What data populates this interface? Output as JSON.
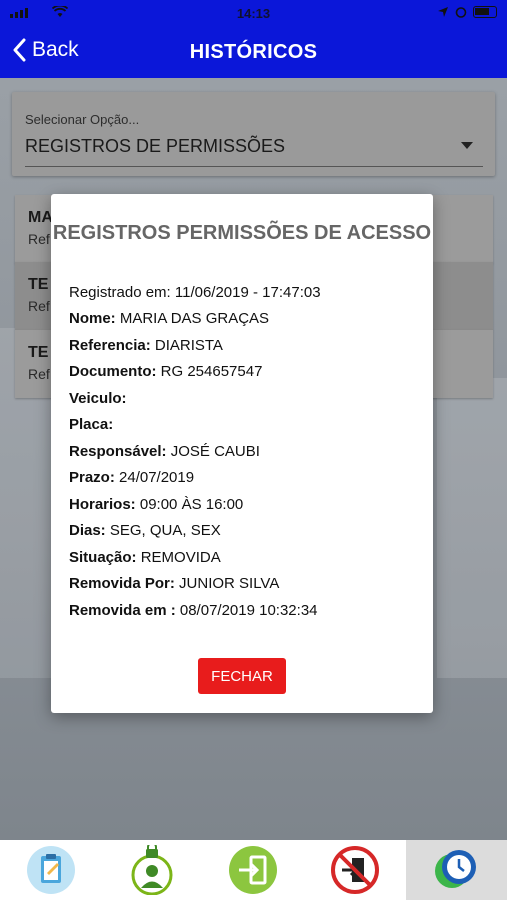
{
  "status_bar": {
    "time": "14:13"
  },
  "header": {
    "back_label": "Back",
    "title": "HISTÓRICOS"
  },
  "select": {
    "label": "Selecionar Opção...",
    "value": "REGISTROS DE PERMISSÕES"
  },
  "list": [
    {
      "title": "MA",
      "subtitle": "Ref"
    },
    {
      "title": "TE",
      "subtitle": "Ref"
    },
    {
      "title": "TE",
      "subtitle": "Ref"
    }
  ],
  "modal": {
    "title": "REGISTROS PERMISSÕES DE ACESSO",
    "registered": "Registrado em: 11/06/2019 - 17:47:03",
    "fields": [
      {
        "label": "Nome:",
        "value": "MARIA DAS GRAÇAS"
      },
      {
        "label": "Referencia:",
        "value": "DIARISTA"
      },
      {
        "label": "Documento:",
        "value": "RG 254657547"
      },
      {
        "label": "Veiculo:",
        "value": ""
      },
      {
        "label": "Placa:",
        "value": ""
      },
      {
        "label": "Responsável:",
        "value": "JOSÉ CAUBI"
      },
      {
        "label": "Prazo:",
        "value": "24/07/2019"
      },
      {
        "label": "Horarios:",
        "value": "09:00 ÀS 16:00"
      },
      {
        "label": "Dias:",
        "value": "SEG, QUA, SEX"
      },
      {
        "label": "Situação:",
        "value": "REMOVIDA"
      },
      {
        "label": "Removida Por:",
        "value": "JUNIOR SILVA"
      },
      {
        "label": "Removida em :",
        "value": "08/07/2019 10:32:34"
      }
    ],
    "close_label": "FECHAR"
  },
  "tabs": [
    {
      "icon": "clipboard-icon",
      "active": false
    },
    {
      "icon": "user-lock-icon",
      "active": false
    },
    {
      "icon": "enter-door-icon",
      "active": false
    },
    {
      "icon": "no-entry-exit-icon",
      "active": false
    },
    {
      "icon": "history-clock-icon",
      "active": true
    }
  ],
  "colors": {
    "header": "#0b17d9",
    "close_button": "#e81c1c",
    "modal_title": "#666666"
  }
}
